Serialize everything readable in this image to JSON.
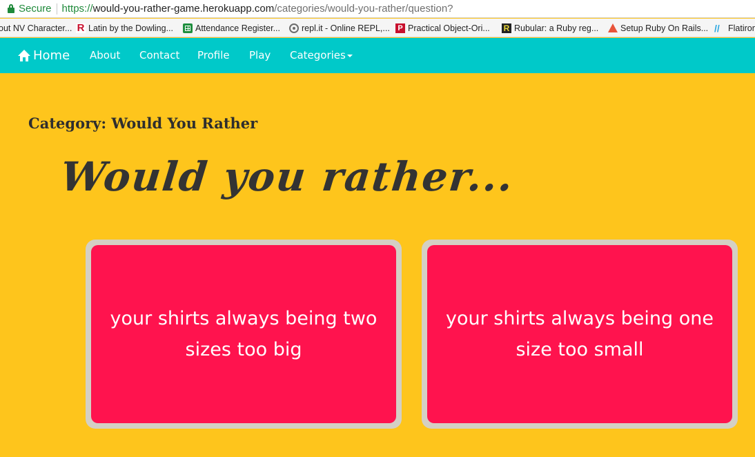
{
  "browser": {
    "secure_label": "Secure",
    "url_scheme": "https://",
    "url_host": "would-you-rather-game.herokuapp.com",
    "url_path": "/categories/would-you-rather/question?"
  },
  "bookmarks": [
    {
      "label": "out NV Character...",
      "icon": "none"
    },
    {
      "label": "Latin by the Dowling...",
      "icon": "rutgers-r-icon"
    },
    {
      "label": "Attendance Register...",
      "icon": "sheets-icon"
    },
    {
      "label": "repl.it - Online REPL,...",
      "icon": "repl-icon"
    },
    {
      "label": "Practical Object-Ori...",
      "icon": "p-icon"
    },
    {
      "label": "Rubular: a Ruby reg...",
      "icon": "rubular-icon"
    },
    {
      "label": "Setup Ruby On Rails...",
      "icon": "rails-icon"
    },
    {
      "label": "Flatiron",
      "icon": "flatiron-icon"
    }
  ],
  "nav": {
    "brand": "Home",
    "about": "About",
    "contact": "Contact",
    "profile": "Profile",
    "play": "Play",
    "categories": "Categories"
  },
  "page": {
    "category_title": "Category: Would You Rather",
    "heading": "Would you rather..."
  },
  "options": [
    {
      "text": "your shirts always being two sizes too big"
    },
    {
      "text": "your shirts always being one size too small"
    }
  ],
  "colors": {
    "background": "#fec51c",
    "navbar": "#00c9c9",
    "card": "#ff134e",
    "card_border": "#d4d0c4"
  }
}
